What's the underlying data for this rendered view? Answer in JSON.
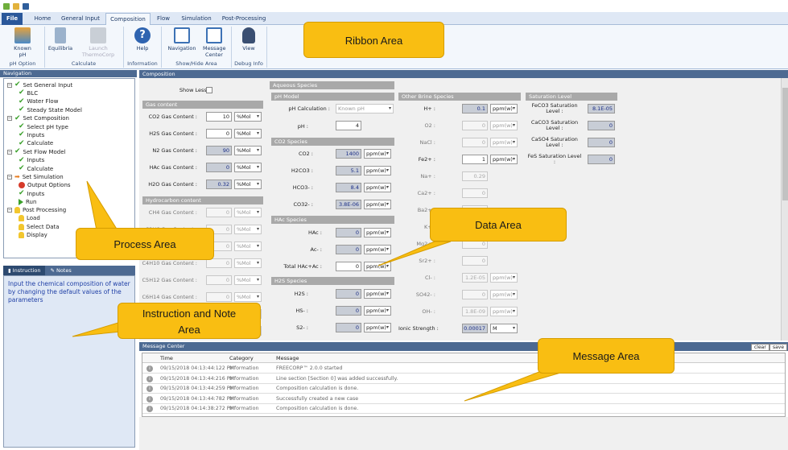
{
  "ribbon": {
    "tabs": [
      "File",
      "Home",
      "General Input",
      "Composition",
      "Flow",
      "Simulation",
      "Post-Processing"
    ],
    "active_tab": "Composition",
    "buttons": {
      "known_ph": "Known pH",
      "equilibria": "Equilibria",
      "launch": "Launch ThermoCorp",
      "help": "Help",
      "navigation": "Navigation",
      "message_center": "Message Center",
      "view": "View"
    },
    "groups": {
      "ph_option": "pH Option",
      "calculate": "Calculate",
      "information": "Information",
      "show_hide": "Show/Hide Area",
      "debug": "Debug Info"
    }
  },
  "navigation": {
    "header": "Navigation",
    "items": [
      {
        "label": "Set General Input",
        "icon": "check",
        "level": 0
      },
      {
        "label": "BLC",
        "icon": "check",
        "level": 1
      },
      {
        "label": "Water Flow",
        "icon": "check",
        "level": 1
      },
      {
        "label": "Steady State Model",
        "icon": "check",
        "level": 1
      },
      {
        "label": "Set Composition",
        "icon": "check",
        "level": 0
      },
      {
        "label": "Select pH type",
        "icon": "check",
        "level": 1
      },
      {
        "label": "Inputs",
        "icon": "check",
        "level": 1
      },
      {
        "label": "Calculate",
        "icon": "check",
        "level": 1
      },
      {
        "label": "Set Flow Model",
        "icon": "check",
        "level": 0
      },
      {
        "label": "Inputs",
        "icon": "check",
        "level": 1
      },
      {
        "label": "Calculate",
        "icon": "check",
        "level": 1
      },
      {
        "label": "Set Simulation",
        "icon": "arrow",
        "level": 0
      },
      {
        "label": "Output Options",
        "icon": "stop",
        "level": 1
      },
      {
        "label": "Inputs",
        "icon": "check",
        "level": 1
      },
      {
        "label": "Run",
        "icon": "run",
        "level": 1
      },
      {
        "label": "Post Processing",
        "icon": "bell",
        "level": 0
      },
      {
        "label": "Load",
        "icon": "bell",
        "level": 1
      },
      {
        "label": "Select Data",
        "icon": "bell",
        "level": 1
      },
      {
        "label": "Display",
        "icon": "bell",
        "level": 1
      }
    ]
  },
  "instruction": {
    "tab_instruction": "Instruction",
    "tab_notes": "Notes",
    "text": "Input the chemical composition of water by changing the default values of the parameters"
  },
  "composition": {
    "header": "Composition",
    "show_less": "Show Less :",
    "gas_content_title": "Gas content",
    "gas": [
      {
        "label": "CO2 Gas Content :",
        "value": "10",
        "unit": "%Mol",
        "state": "input"
      },
      {
        "label": "H2S Gas Content :",
        "value": "0",
        "unit": "%Mol",
        "state": "input"
      },
      {
        "label": "N2 Gas Content :",
        "value": "90",
        "unit": "%Mol",
        "state": "calc"
      },
      {
        "label": "HAc Gas Content :",
        "value": "0",
        "unit": "%Mol",
        "state": "calc"
      },
      {
        "label": "H2O Gas Content :",
        "value": "0.32",
        "unit": "%Mol",
        "state": "calc"
      }
    ],
    "hydrocarbon_title": "Hydrocarbon content",
    "hydrocarbon": [
      {
        "label": "CH4 Gas Content :",
        "value": "0",
        "unit": "%Mol"
      },
      {
        "label": "C2H6 Gas Content :",
        "value": "0",
        "unit": "%Mol"
      },
      {
        "label": "C3H8 Gas Content :",
        "value": "0",
        "unit": "%Mol"
      },
      {
        "label": "C4H10 Gas Content :",
        "value": "0",
        "unit": "%Mol"
      },
      {
        "label": "C5H12 Gas Content :",
        "value": "0",
        "unit": "%Mol"
      },
      {
        "label": "C6H14 Gas Content :",
        "value": "0",
        "unit": "%Mol"
      },
      {
        "label": "",
        "value": "",
        "unit": "%Mol"
      },
      {
        "label": "",
        "value": "",
        "unit": "%Mol"
      }
    ],
    "aqueous_title": "Aqueous Species",
    "ph_model_title": "pH Model",
    "ph_calc_label": "pH Calculation :",
    "ph_calc_value": "Known pH",
    "ph_label": "pH :",
    "ph_value": "4",
    "co2_species_title": "CO2 Species",
    "co2_species": [
      {
        "label": "CO2 :",
        "value": "1400",
        "unit": "ppm(w)"
      },
      {
        "label": "H2CO3 :",
        "value": "5.1",
        "unit": "ppm(w)"
      },
      {
        "label": "HCO3- :",
        "value": "8.4",
        "unit": "ppm(w)"
      },
      {
        "label": "CO32- :",
        "value": "3.8E-06",
        "unit": "ppm(w)"
      }
    ],
    "hac_species_title": "HAc Species",
    "hac_species": [
      {
        "label": "HAc :",
        "value": "0",
        "unit": "ppm(w)",
        "state": "calc"
      },
      {
        "label": "Ac- :",
        "value": "0",
        "unit": "ppm(w)",
        "state": "calc"
      },
      {
        "label": "Total HAc+Ac :",
        "value": "0",
        "unit": "ppm(w)",
        "state": "input"
      }
    ],
    "h2s_species_title": "H2S Species",
    "h2s_species": [
      {
        "label": "H2S :",
        "value": "0",
        "unit": "ppm(w)"
      },
      {
        "label": "HS- :",
        "value": "0",
        "unit": "ppm(w)"
      },
      {
        "label": "S2- :",
        "value": "0",
        "unit": "ppm(w)"
      }
    ],
    "brine_title": "Other Brine Species",
    "brine": [
      {
        "label": "H+ :",
        "value": "0.1",
        "unit": "ppm(w)",
        "state": "calc"
      },
      {
        "label": "O2 :",
        "value": "0",
        "unit": "ppm(w)",
        "state": "dis"
      },
      {
        "label": "NaCl :",
        "value": "0",
        "unit": "ppm(w)",
        "state": "dis"
      },
      {
        "label": "Fe2+ :",
        "value": "1",
        "unit": "ppm(w)",
        "state": "input"
      },
      {
        "label": "Na+ :",
        "value": "0.29",
        "unit": "",
        "state": "dis"
      },
      {
        "label": "Ca2+ :",
        "value": "0",
        "unit": "",
        "state": "dis"
      },
      {
        "label": "Ba2+ :",
        "value": "0",
        "unit": "",
        "state": "dis"
      },
      {
        "label": "K+ :",
        "value": "0",
        "unit": "",
        "state": "dis"
      },
      {
        "label": "Mg2+ :",
        "value": "0",
        "unit": "",
        "state": "dis"
      },
      {
        "label": "Sr2+ :",
        "value": "0",
        "unit": "",
        "state": "dis"
      },
      {
        "label": "Cl- :",
        "value": "1.2E-05",
        "unit": "ppm(w)",
        "state": "dis"
      },
      {
        "label": "SO42- :",
        "value": "0",
        "unit": "ppm(w)",
        "state": "dis"
      },
      {
        "label": "OH- :",
        "value": "1.8E-09",
        "unit": "ppm(w)",
        "state": "dis"
      },
      {
        "label": "Ionic Strength :",
        "value": "0.00017",
        "unit": "M",
        "state": "calc"
      }
    ],
    "saturation_title": "Saturation Level",
    "saturation": [
      {
        "label": "FeCO3 Saturation Level :",
        "value": "8.1E-05"
      },
      {
        "label": "CaCO3 Saturation Level :",
        "value": "0"
      },
      {
        "label": "CaSO4 Saturation Level :",
        "value": "0"
      },
      {
        "label": "FeS Saturation Level :",
        "value": "0"
      }
    ]
  },
  "messages": {
    "header": "Message Center",
    "clear": "clear",
    "save": "save",
    "columns": [
      "Time",
      "Category",
      "Message"
    ],
    "rows": [
      {
        "time": "09/15/2018 04:13:44:122 PM",
        "category": "Information",
        "message": "FREECORP™ 2.0.0 started"
      },
      {
        "time": "09/15/2018 04:13:44:216 PM",
        "category": "Information",
        "message": "Line section [Section 0] was added successfully."
      },
      {
        "time": "09/15/2018 04:13:44:259 PM",
        "category": "Information",
        "message": "Composition calculation is done."
      },
      {
        "time": "09/15/2018 04:13:44:782 PM",
        "category": "Information",
        "message": "Successfully created a new case"
      },
      {
        "time": "09/15/2018 04:14:38:272 PM",
        "category": "Information",
        "message": "Composition calculation is done."
      }
    ]
  },
  "callouts": {
    "ribbon": "Ribbon Area",
    "process": "Process Area",
    "instruction_line1": "Instruction and Note",
    "instruction_line2": "Area",
    "data": "Data Area",
    "message": "Message Area"
  },
  "colors": {
    "accent": "#2a579a",
    "panel_header": "#4d6a92",
    "callout": "#f9be12",
    "instruction_text": "#1f3fa6"
  }
}
